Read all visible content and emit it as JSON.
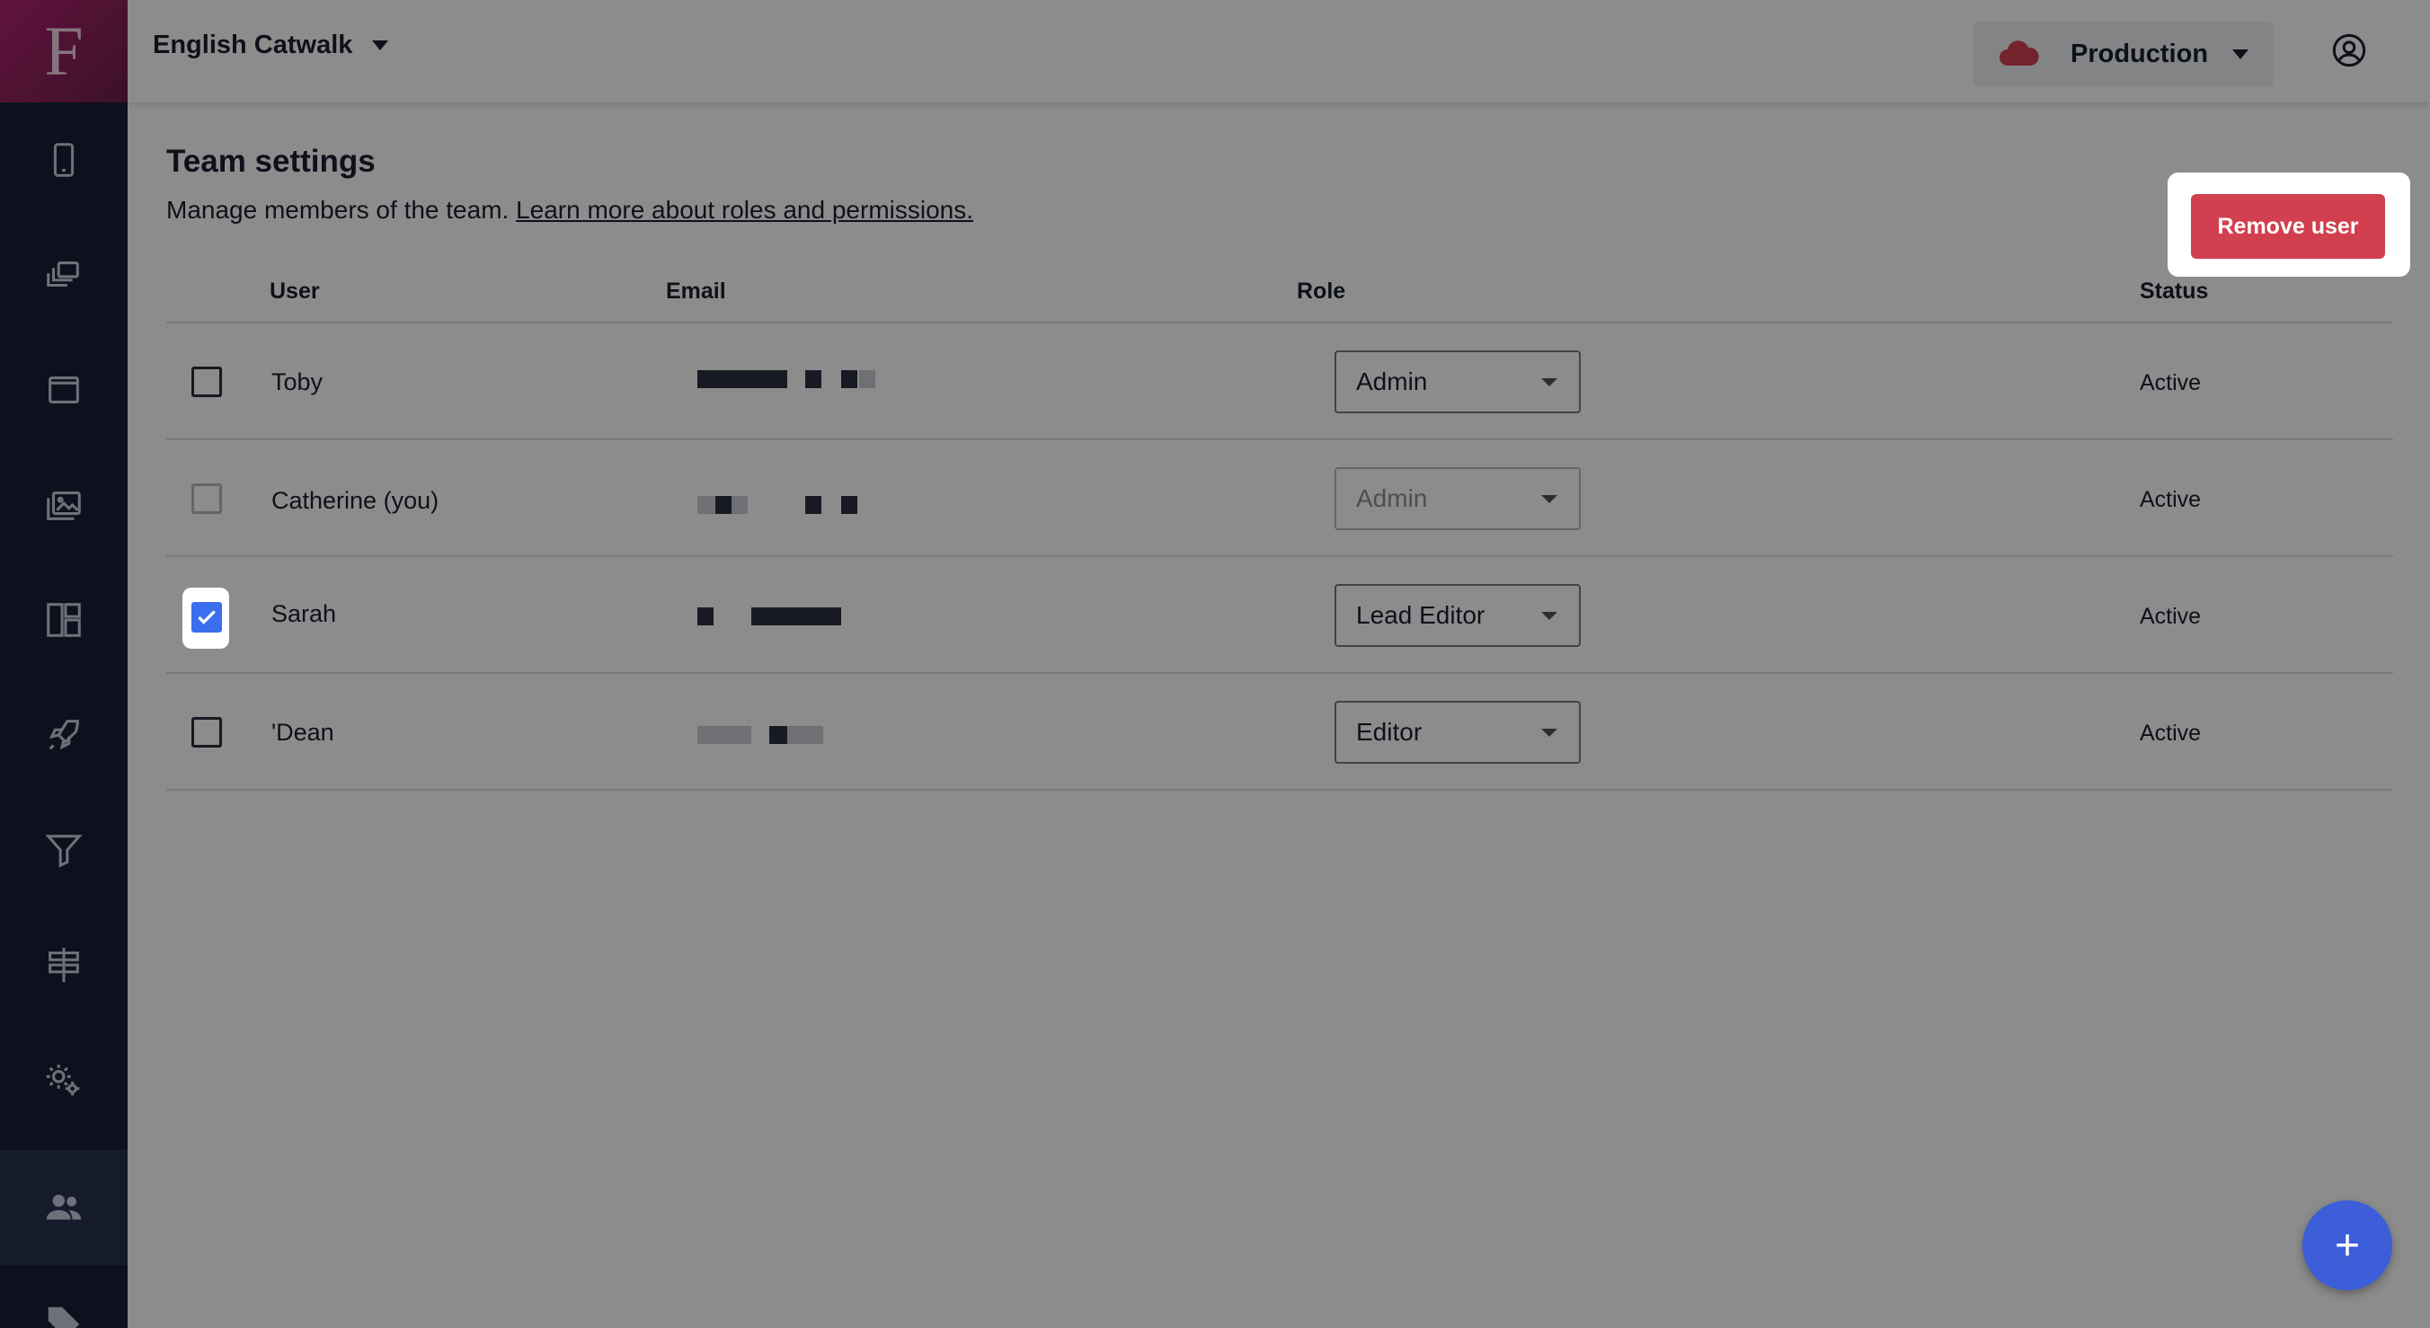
{
  "topbar": {
    "app_name": "English Catwalk",
    "environment": "Production"
  },
  "sidebar": {
    "items": [
      {
        "icon": "phone-icon"
      },
      {
        "icon": "screens-icon"
      },
      {
        "icon": "window-icon"
      },
      {
        "icon": "images-icon"
      },
      {
        "icon": "layout-icon"
      },
      {
        "icon": "rocket-icon"
      },
      {
        "icon": "filter-icon"
      },
      {
        "icon": "signpost-icon"
      },
      {
        "icon": "settings-icon"
      },
      {
        "icon": "team-icon",
        "active": true
      },
      {
        "icon": "tag-icon"
      }
    ]
  },
  "page": {
    "title": "Team settings",
    "subtitle": "Manage members of the team.",
    "learn_more": "Learn more about roles and permissions.",
    "remove_user_label": "Remove user"
  },
  "table": {
    "headers": {
      "user": "User",
      "email": "Email",
      "role": "Role",
      "status": "Status"
    },
    "rows": [
      {
        "name": "Toby",
        "role": "Admin",
        "status": "Active",
        "checked": false,
        "disabled": false
      },
      {
        "name": "Catherine (you)",
        "role": "Admin",
        "status": "Active",
        "checked": false,
        "disabled": true
      },
      {
        "name": "Sarah",
        "role": "Lead Editor",
        "status": "Active",
        "checked": true,
        "disabled": false
      },
      {
        "name": "'Dean",
        "role": "Editor",
        "status": "Active",
        "checked": false,
        "disabled": false
      }
    ]
  },
  "fab": {
    "label": "+"
  },
  "colors": {
    "sidebar": "#1a2035",
    "remove_button": "#d2404f",
    "checkbox_checked": "#3a6ff0",
    "fab": "#3c5ed8",
    "env_cloud": "#d2404f"
  }
}
